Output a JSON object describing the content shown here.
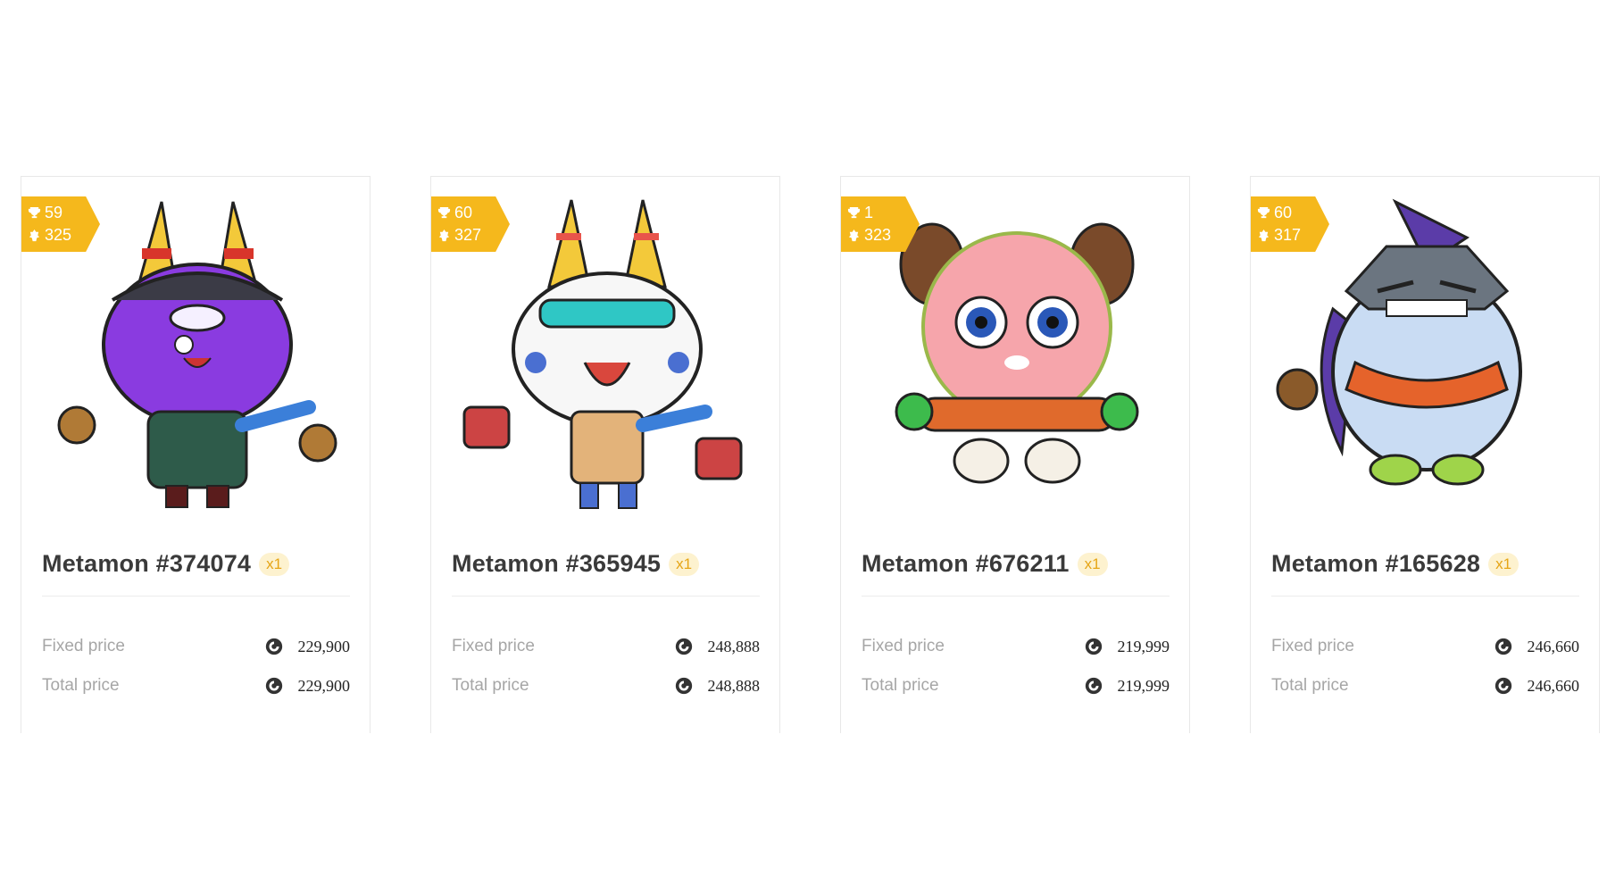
{
  "cards": [
    {
      "name": "Metamon #374074",
      "quantity": "x1",
      "level": "59",
      "score": "325",
      "fixed_label": "Fixed price",
      "fixed_price": "229,900",
      "total_label": "Total price",
      "total_price": "229,900"
    },
    {
      "name": "Metamon #365945",
      "quantity": "x1",
      "level": "60",
      "score": "327",
      "fixed_label": "Fixed price",
      "fixed_price": "248,888",
      "total_label": "Total price",
      "total_price": "248,888"
    },
    {
      "name": "Metamon #676211",
      "quantity": "x1",
      "level": "1",
      "score": "323",
      "fixed_label": "Fixed price",
      "fixed_price": "219,999",
      "total_label": "Total price",
      "total_price": "219,999"
    },
    {
      "name": "Metamon #165628",
      "quantity": "x1",
      "level": "60",
      "score": "317",
      "fixed_label": "Fixed price",
      "fixed_price": "246,660",
      "total_label": "Total price",
      "total_price": "246,660"
    }
  ],
  "icons": {
    "badge_level": "trophy-icon",
    "badge_score": "power-icon",
    "currency": "coin-icon"
  },
  "colors": {
    "badge": "#f5b81c",
    "qty_bg": "#fdf2cf",
    "qty_text": "#e6a516",
    "title": "#3a3a3a",
    "label": "#a6a6a6"
  }
}
